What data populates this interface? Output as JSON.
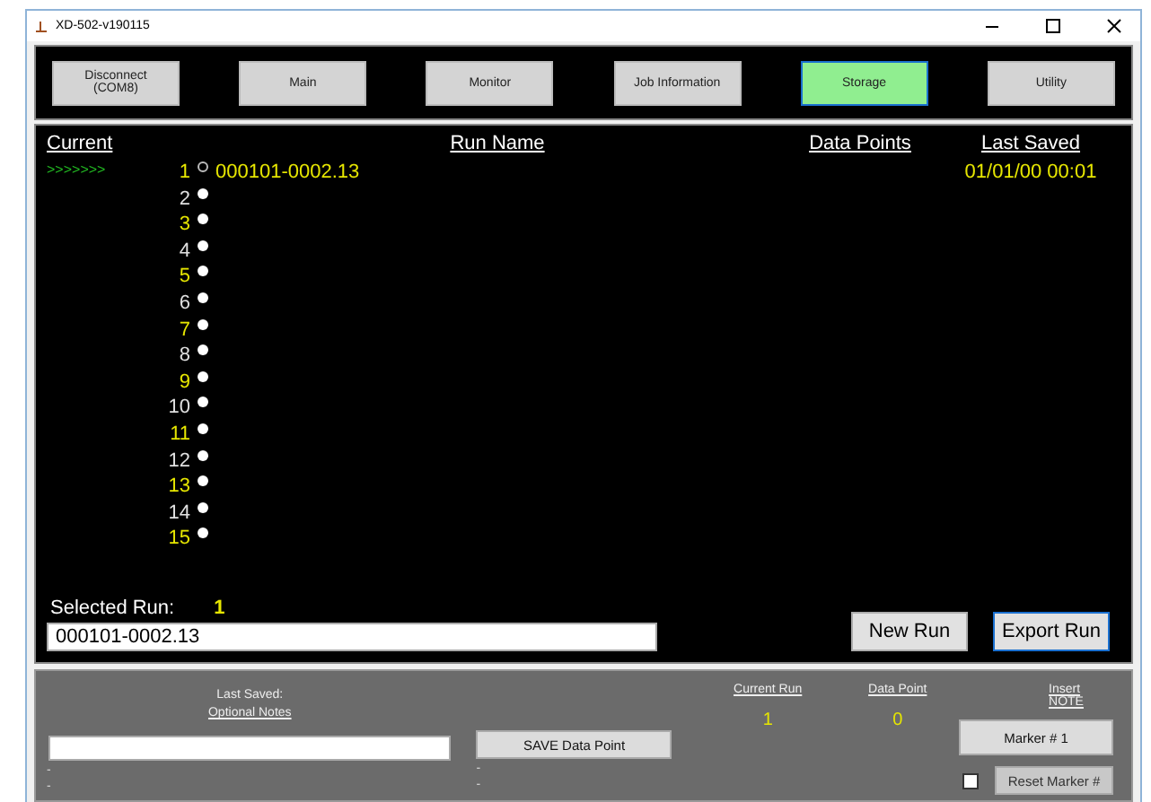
{
  "window": {
    "title": "XD-502-v190115"
  },
  "nav": [
    {
      "label": "Disconnect\n(COM8)",
      "selected": false
    },
    {
      "label": "Main",
      "selected": false
    },
    {
      "label": "Monitor",
      "selected": false
    },
    {
      "label": "Job Information",
      "selected": false
    },
    {
      "label": "Storage",
      "selected": true
    },
    {
      "label": "Utility",
      "selected": false
    }
  ],
  "runs": {
    "columns": [
      "Current",
      "Run Name",
      "Data Points",
      "Last Saved"
    ],
    "rows": [
      {
        "current": ">>>>>>>",
        "number": "1",
        "selected": true,
        "name": "000101-0002.13",
        "last_saved": "01/01/00 00:01",
        "color": "#e6e600"
      },
      {
        "number": "2",
        "selected": false,
        "color": "#e0e0e0"
      },
      {
        "number": "3",
        "selected": false,
        "color": "#e6e600"
      },
      {
        "number": "4",
        "selected": false,
        "color": "#e0e0e0"
      },
      {
        "number": "5",
        "selected": false,
        "color": "#e6e600"
      },
      {
        "number": "6",
        "selected": false,
        "color": "#e0e0e0"
      },
      {
        "number": "7",
        "selected": false,
        "color": "#e6e600"
      },
      {
        "number": "8",
        "selected": false,
        "color": "#e0e0e0"
      },
      {
        "number": "9",
        "selected": false,
        "color": "#e6e600"
      },
      {
        "number": "10",
        "selected": false,
        "color": "#e0e0e0"
      },
      {
        "number": "11",
        "selected": false,
        "color": "#e6e600"
      },
      {
        "number": "12",
        "selected": false,
        "color": "#e0e0e0"
      },
      {
        "number": "13",
        "selected": false,
        "color": "#e6e600"
      },
      {
        "number": "14",
        "selected": false,
        "color": "#e0e0e0"
      },
      {
        "number": "15",
        "selected": false,
        "color": "#e6e600"
      }
    ],
    "selected_run_label": "Selected Run:",
    "selected_run": "1",
    "run_field": "000101-0002.13",
    "buttons": [
      {
        "label": "New Run",
        "selected": false
      },
      {
        "label": "Export Run",
        "selected": true
      }
    ]
  },
  "bottom": {
    "last_saved_label": "Last Saved:",
    "notes_label": "Optional Notes",
    "notes_lines": [
      "-",
      "-"
    ],
    "save_button": "SAVE Data Point",
    "save_lines": [
      "-",
      "-"
    ],
    "current_run_label": "Current Run",
    "current_run": "1",
    "data_point_label": "Data Point",
    "data_point": "0",
    "insert_note_label": "Insert NOTE",
    "marker_button": "Marker # 1",
    "reset_checked": false,
    "reset_button": "Reset Marker #"
  }
}
